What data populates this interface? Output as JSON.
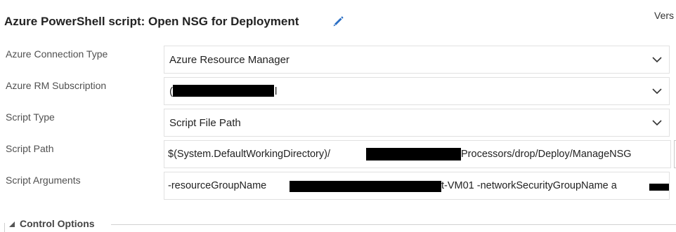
{
  "task": {
    "title": "Azure PowerShell script: Open NSG for Deployment",
    "edit_icon": "pencil-icon",
    "version_label": "Vers"
  },
  "fields": [
    {
      "label": "Azure Connection Type",
      "value": "Azure Resource Manager",
      "control": "dropdown"
    },
    {
      "label": "Azure RM Subscription",
      "value_prefix": "(",
      "value_suffix": "l",
      "control": "dropdown",
      "redacted": true
    },
    {
      "label": "Script Type",
      "value": "Script File Path",
      "control": "dropdown"
    },
    {
      "label": "Script Path",
      "value_prefix": "$(System.DefaultWorkingDirectory)/",
      "value_suffix": "Processors/drop/Deploy/ManageNSG",
      "control": "text",
      "redacted": true
    },
    {
      "label": "Script Arguments",
      "value_prefix": "-resourceGroupName ",
      "value_suffix": "t-VM01 -networkSecurityGroupName a",
      "control": "text",
      "redacted": true
    }
  ],
  "section": {
    "title": "Control Options",
    "expand_icon": "triangle-collapse-icon"
  },
  "colors": {
    "edit_icon": "#2b6fc4",
    "border": "#e1e1e1",
    "redaction": "#000000"
  }
}
